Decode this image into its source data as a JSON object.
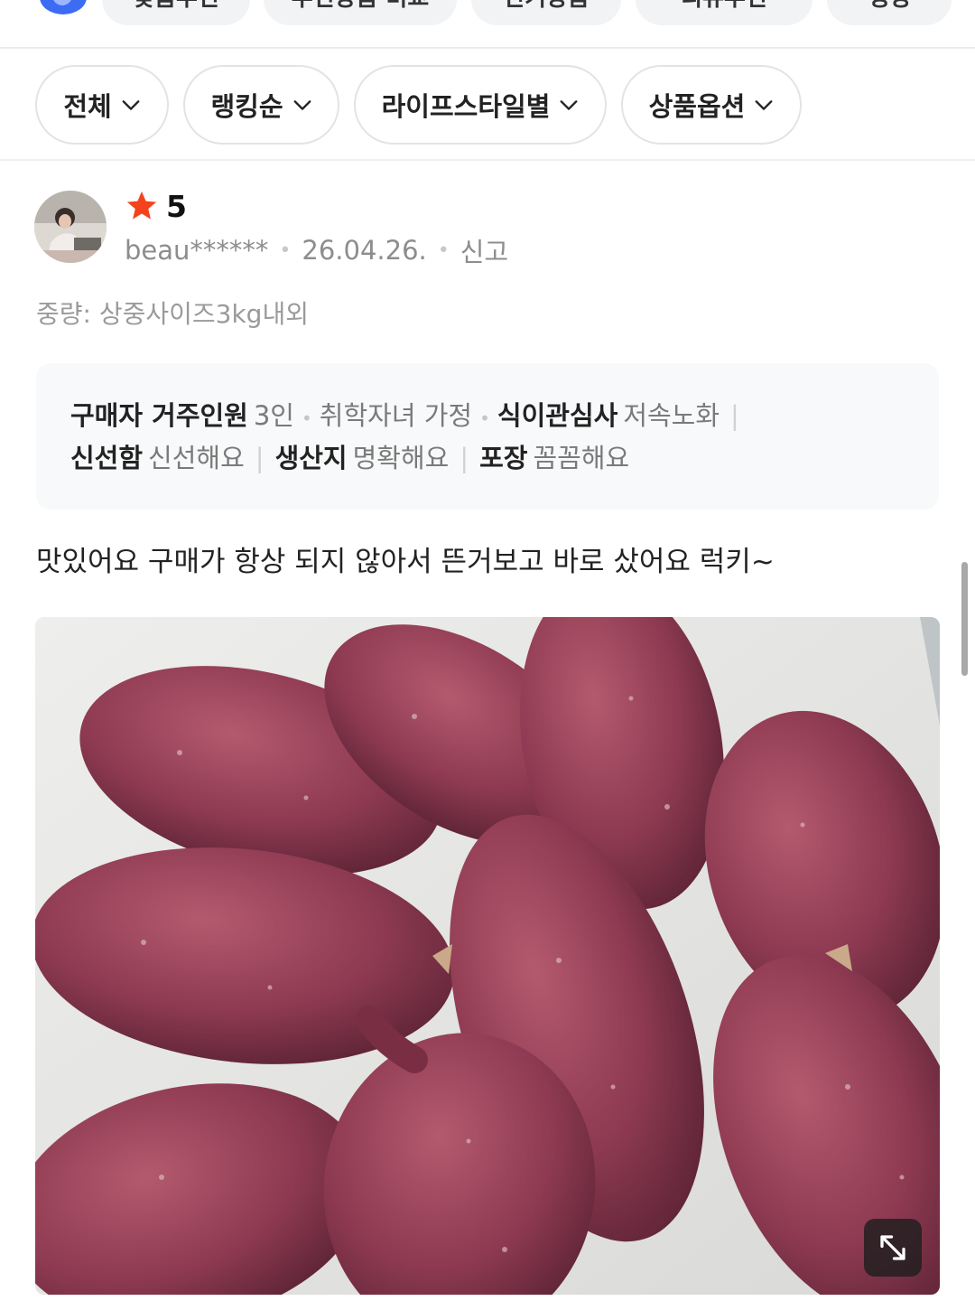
{
  "top_tabs": [
    {
      "label": "맞춤추천"
    },
    {
      "label": "추천상품 비교"
    },
    {
      "label": "인기상품"
    },
    {
      "label": "리뷰추천"
    },
    {
      "label": "랭킹"
    }
  ],
  "filters": [
    {
      "label": "전체"
    },
    {
      "label": "랭킹순"
    },
    {
      "label": "라이프스타일별"
    },
    {
      "label": "상품옵션"
    }
  ],
  "review": {
    "rating": "5",
    "user": "beau******",
    "date": "26.04.26.",
    "report_label": "신고",
    "option": "중량: 상중사이즈3kg내외",
    "survey": {
      "household_key": "구매자 거주인원",
      "household_value": "3인",
      "family_value": "취학자녀 가정",
      "diet_key": "식이관심사",
      "diet_value": "저속노화",
      "freshness_key": "신선함",
      "freshness_value": "신선해요",
      "origin_key": "생산지",
      "origin_value": "명확해요",
      "packaging_key": "포장",
      "packaging_value": "꼼꼼해요"
    },
    "text": "맛있어요 구매가 항상 되지 않아서 뜬거보고 바로 샀어요 럭키~"
  },
  "icons": {
    "star": "star-icon",
    "chevron": "chevron-down-icon",
    "expand": "expand-icon"
  },
  "colors": {
    "star": "#f4431c",
    "text_primary": "#222222",
    "text_secondary": "#8d8d8d"
  }
}
